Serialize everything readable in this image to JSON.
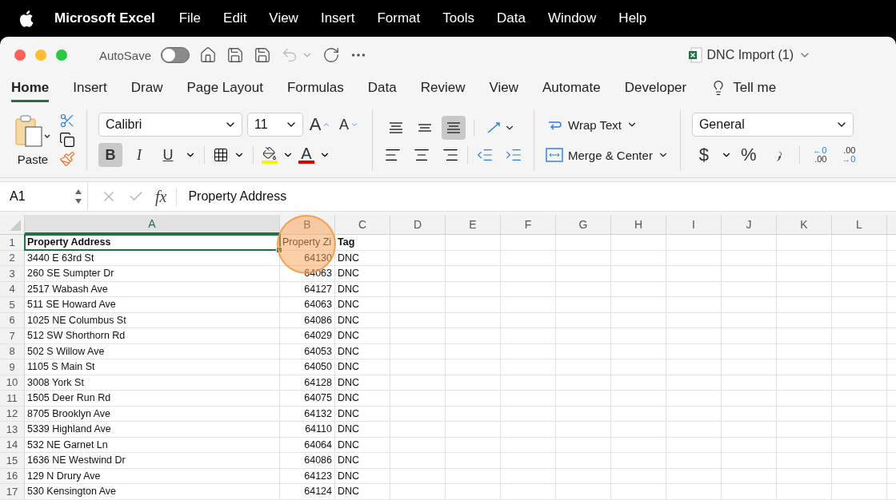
{
  "menu_bar": {
    "app_name": "Microsoft Excel",
    "items": [
      "File",
      "Edit",
      "View",
      "Insert",
      "Format",
      "Tools",
      "Data",
      "Window",
      "Help"
    ]
  },
  "title_bar": {
    "autosave_label": "AutoSave",
    "autosave_on": false,
    "document_title": "DNC Import (1)"
  },
  "ribbon_tabs": [
    {
      "label": "Home",
      "selected": true
    },
    {
      "label": "Insert",
      "selected": false
    },
    {
      "label": "Draw",
      "selected": false
    },
    {
      "label": "Page Layout",
      "selected": false
    },
    {
      "label": "Formulas",
      "selected": false
    },
    {
      "label": "Data",
      "selected": false
    },
    {
      "label": "Review",
      "selected": false
    },
    {
      "label": "View",
      "selected": false
    },
    {
      "label": "Automate",
      "selected": false
    },
    {
      "label": "Developer",
      "selected": false
    }
  ],
  "tell_me": "Tell me",
  "ribbon": {
    "paste_label": "Paste",
    "font_name": "Calibri",
    "font_size": "11",
    "grow_font": "A",
    "shrink_font": "A",
    "style_buttons": [
      {
        "glyph": "B",
        "kind": "bold",
        "selected": true
      },
      {
        "glyph": "I",
        "kind": "italic",
        "selected": false
      },
      {
        "glyph": "U",
        "kind": "underline",
        "selected": false
      }
    ],
    "font_color_glyph": "A",
    "vertical_align": [
      {
        "kind": "top",
        "selected": false
      },
      {
        "kind": "middle",
        "selected": false
      },
      {
        "kind": "bottom",
        "selected": true
      }
    ],
    "wrap_text": "Wrap Text",
    "merge_center": "Merge & Center",
    "number_format": "General",
    "currency": "$",
    "percent": "%",
    "increase_decimal": {
      "top": "←0",
      "bottom": ".00"
    },
    "decrease_decimal": {
      "top": ".00",
      "bottom": "→0"
    }
  },
  "formula_bar": {
    "name_box": "A1",
    "fx": "fx",
    "formula": "Property Address"
  },
  "sheet": {
    "columns": [
      {
        "label": "A",
        "selected": true
      },
      {
        "label": "B",
        "selected": false
      },
      {
        "label": "C",
        "selected": false
      },
      {
        "label": "D",
        "selected": false
      },
      {
        "label": "E",
        "selected": false
      },
      {
        "label": "F",
        "selected": false
      },
      {
        "label": "G",
        "selected": false
      },
      {
        "label": "H",
        "selected": false
      },
      {
        "label": "I",
        "selected": false
      },
      {
        "label": "J",
        "selected": false
      },
      {
        "label": "K",
        "selected": false
      },
      {
        "label": "L",
        "selected": false
      }
    ],
    "rows": [
      {
        "number": "1",
        "selected": true,
        "kind": "header",
        "cells": [
          "Property Address",
          "Property Zi",
          "Tag"
        ]
      },
      {
        "number": "2",
        "selected": false,
        "kind": "data",
        "cells": [
          "3440 E 63rd St",
          "64130",
          "DNC"
        ]
      },
      {
        "number": "3",
        "selected": false,
        "kind": "data",
        "cells": [
          "260 SE Sumpter Dr",
          "64063",
          "DNC"
        ]
      },
      {
        "number": "4",
        "selected": false,
        "kind": "data",
        "cells": [
          "2517 Wabash Ave",
          "64127",
          "DNC"
        ]
      },
      {
        "number": "5",
        "selected": false,
        "kind": "data",
        "cells": [
          "511 SE Howard Ave",
          "64063",
          "DNC"
        ]
      },
      {
        "number": "6",
        "selected": false,
        "kind": "data",
        "cells": [
          "1025 NE Columbus St",
          "64086",
          "DNC"
        ]
      },
      {
        "number": "7",
        "selected": false,
        "kind": "data",
        "cells": [
          "512 SW Shorthorn Rd",
          "64029",
          "DNC"
        ]
      },
      {
        "number": "8",
        "selected": false,
        "kind": "data",
        "cells": [
          "502 S Willow Ave",
          "64053",
          "DNC"
        ]
      },
      {
        "number": "9",
        "selected": false,
        "kind": "data",
        "cells": [
          "1105 S Main St",
          "64050",
          "DNC"
        ]
      },
      {
        "number": "10",
        "selected": false,
        "kind": "data",
        "cells": [
          "3008 York St",
          "64128",
          "DNC"
        ]
      },
      {
        "number": "11",
        "selected": false,
        "kind": "data",
        "cells": [
          "1505 Deer Run Rd",
          "64075",
          "DNC"
        ]
      },
      {
        "number": "12",
        "selected": false,
        "kind": "data",
        "cells": [
          "8705 Brooklyn Ave",
          "64132",
          "DNC"
        ]
      },
      {
        "number": "13",
        "selected": false,
        "kind": "data",
        "cells": [
          "5339 Highland Ave",
          "64110",
          "DNC"
        ]
      },
      {
        "number": "14",
        "selected": false,
        "kind": "data",
        "cells": [
          "532 NE Garnet Ln",
          "64064",
          "DNC"
        ]
      },
      {
        "number": "15",
        "selected": false,
        "kind": "data",
        "cells": [
          "1636 NE Westwind Dr",
          "64086",
          "DNC"
        ]
      },
      {
        "number": "16",
        "selected": false,
        "kind": "data",
        "cells": [
          "129 N Drury Ave",
          "64123",
          "DNC"
        ]
      },
      {
        "number": "17",
        "selected": false,
        "kind": "data",
        "cells": [
          "530 Kensington Ave",
          "64124",
          "DNC"
        ]
      }
    ]
  }
}
